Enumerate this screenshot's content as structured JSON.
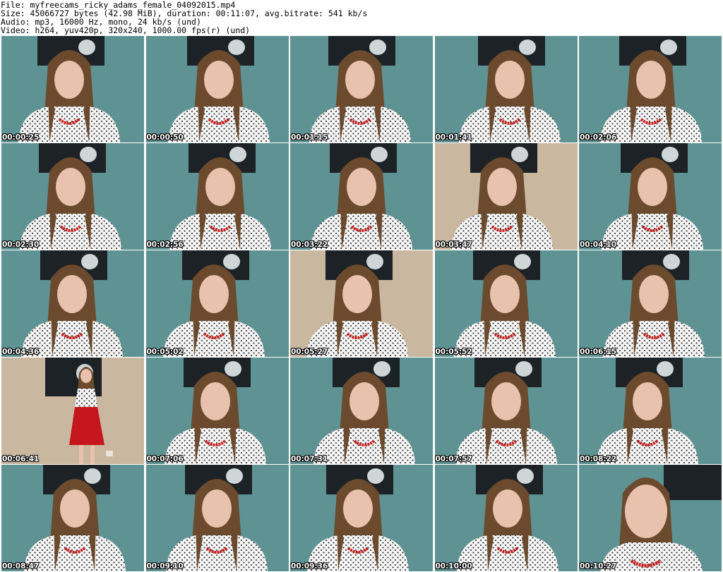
{
  "header": {
    "file_line": "File: myfreecams_ricky_adams_female_04092015.mp4",
    "size_line": "Size: 45066727 bytes (42.98 MiB), duration: 00:11:07, avg.bitrate: 541 kb/s",
    "audio_line": "Audio: mp3, 16000 Hz, mono, 24 kb/s (und)",
    "video_line": "Video: h264, yuv420p, 320x240, 1000.00 fps(r) (und)"
  },
  "colors": {
    "wall_teal": "#5f9393",
    "wall_beige": "#c9b79f",
    "hair": "#6b4a2e",
    "skin": "#e9c2ad",
    "shirt": "#f4f4f4",
    "dots": "#1a1a1a",
    "necklace": "#c41e1e",
    "skirt": "#c4161c",
    "poster": "#1c2226"
  },
  "thumbnails": [
    {
      "time": "00:00:25",
      "scene": "teal"
    },
    {
      "time": "00:00:50",
      "scene": "teal"
    },
    {
      "time": "00:01:15",
      "scene": "teal"
    },
    {
      "time": "00:01:41",
      "scene": "teal"
    },
    {
      "time": "00:02:06",
      "scene": "teal"
    },
    {
      "time": "00:02:30",
      "scene": "teal"
    },
    {
      "time": "00:02:56",
      "scene": "teal"
    },
    {
      "time": "00:03:22",
      "scene": "teal"
    },
    {
      "time": "00:03:47",
      "scene": "beige"
    },
    {
      "time": "00:04:10",
      "scene": "teal"
    },
    {
      "time": "00:04:36",
      "scene": "teal"
    },
    {
      "time": "00:05:02",
      "scene": "teal"
    },
    {
      "time": "00:05:27",
      "scene": "beige"
    },
    {
      "time": "00:05:52",
      "scene": "teal"
    },
    {
      "time": "00:06:15",
      "scene": "teal"
    },
    {
      "time": "00:06:41",
      "scene": "fullbody"
    },
    {
      "time": "00:07:06",
      "scene": "teal"
    },
    {
      "time": "00:07:31",
      "scene": "teal"
    },
    {
      "time": "00:07:57",
      "scene": "teal"
    },
    {
      "time": "00:08:22",
      "scene": "teal"
    },
    {
      "time": "00:08:47",
      "scene": "teal"
    },
    {
      "time": "00:09:10",
      "scene": "teal"
    },
    {
      "time": "00:09:36",
      "scene": "teal"
    },
    {
      "time": "00:10:00",
      "scene": "teal"
    },
    {
      "time": "00:10:27",
      "scene": "closeup"
    }
  ]
}
